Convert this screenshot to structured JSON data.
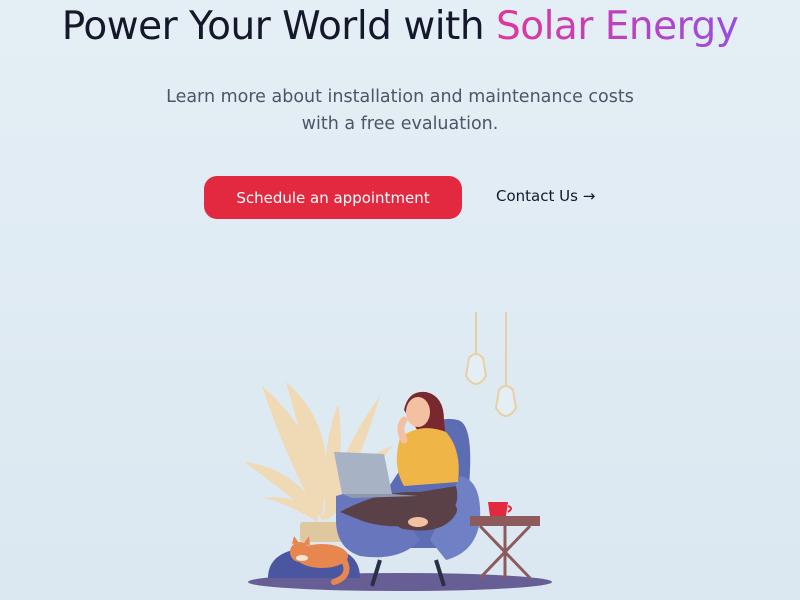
{
  "hero": {
    "title_prefix": "Power Your World with ",
    "title_accent": "Solar Energy",
    "subtitle": "Learn more about installation and maintenance costs with a free evaluation."
  },
  "cta": {
    "primary_label": "Schedule an appointment",
    "secondary_label": "Contact Us",
    "secondary_arrow": "→"
  },
  "colors": {
    "background": "#dfebf3",
    "primary_button": "#e2293f",
    "accent_gradient_start": "#e0359a",
    "accent_gradient_end": "#9b4de0",
    "text": "#15182b"
  },
  "icons": {
    "contact_arrow": "arrow-right-icon"
  }
}
